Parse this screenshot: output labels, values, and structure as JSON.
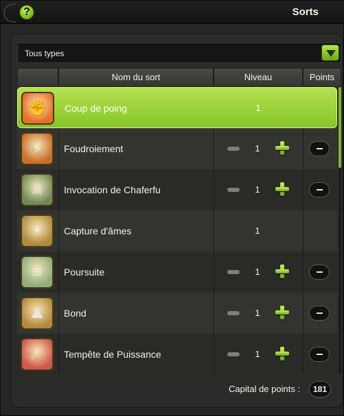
{
  "window": {
    "title": "Sorts",
    "help_label": "?"
  },
  "filter": {
    "selected": "Tous types"
  },
  "table": {
    "columns": {
      "name": "Nom du sort",
      "level": "Niveau",
      "points": "Points"
    },
    "rows": [
      {
        "name": "Coup de poing",
        "level": "1",
        "selected": true,
        "upgradable": false,
        "icon": "fist-icon",
        "icon_color": "#e8702a"
      },
      {
        "name": "Foudroiement",
        "level": "1",
        "selected": false,
        "upgradable": true,
        "icon": "lightning-icon",
        "icon_color": "#c9702a"
      },
      {
        "name": "Invocation de Chaferfu",
        "level": "1",
        "selected": false,
        "upgradable": true,
        "icon": "skull-icon",
        "icon_color": "#6f8a58"
      },
      {
        "name": "Capture d'âmes",
        "level": "1",
        "selected": false,
        "upgradable": false,
        "icon": "soul-capture-icon",
        "icon_color": "#b08a3a"
      },
      {
        "name": "Poursuite",
        "level": "1",
        "selected": false,
        "upgradable": true,
        "icon": "wind-swirl-icon",
        "icon_color": "#8fae7c"
      },
      {
        "name": "Bond",
        "level": "1",
        "selected": false,
        "upgradable": true,
        "icon": "leap-icon",
        "icon_color": "#b58a3c"
      },
      {
        "name": "Tempête de Puissance",
        "level": "1",
        "selected": false,
        "upgradable": true,
        "icon": "power-storm-icon",
        "icon_color": "#d05a4a"
      }
    ]
  },
  "footer": {
    "capital_label": "Capital de points :",
    "capital_value": "181"
  },
  "colors": {
    "accent": "#86c42a",
    "background": "#262724"
  }
}
